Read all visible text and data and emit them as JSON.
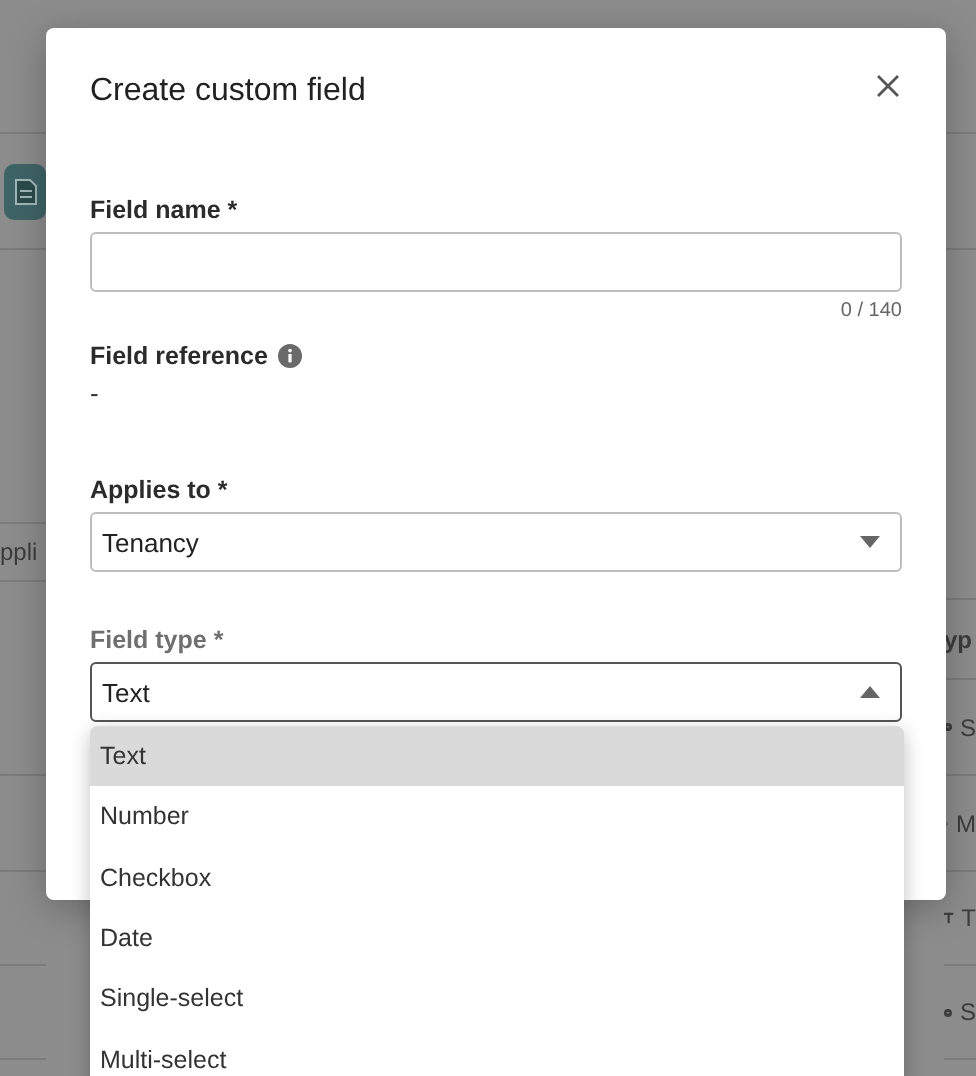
{
  "background": {
    "left_header": "ppli",
    "right_header": "yp",
    "right_rows": [
      {
        "kind": "dot",
        "text": "S"
      },
      {
        "kind": "list",
        "text": "M"
      },
      {
        "kind": "type",
        "text": "T"
      },
      {
        "kind": "dot",
        "text": "S"
      }
    ]
  },
  "dialog": {
    "title": "Create custom field",
    "fields": [
      {
        "kind": "text",
        "label": "Field name *",
        "counter": "0 / 140"
      },
      {
        "kind": "readonly",
        "label": "Field reference",
        "value": "-"
      },
      {
        "kind": "select",
        "label": "Applies to *",
        "value": "Tenancy",
        "open": false
      },
      {
        "kind": "select",
        "label": "Field type *",
        "value": "Text",
        "open": true,
        "options": [
          {
            "label": "Text",
            "selected": true
          },
          {
            "label": "Number",
            "selected": false
          },
          {
            "label": "Checkbox",
            "selected": false
          },
          {
            "label": "Date",
            "selected": false
          },
          {
            "label": "Single-select",
            "selected": false
          },
          {
            "label": "Multi-select",
            "selected": false
          }
        ]
      }
    ]
  }
}
